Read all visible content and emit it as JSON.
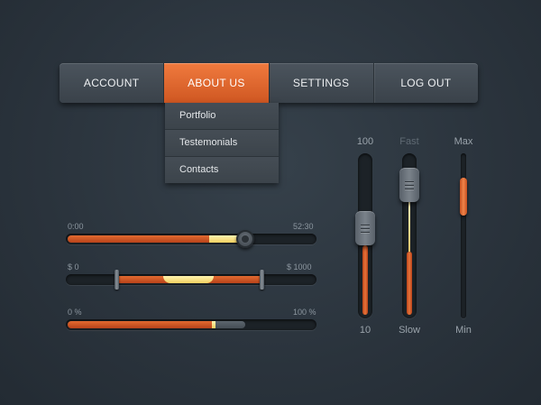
{
  "nav": {
    "items": [
      {
        "label": "ACCOUNT",
        "active": false
      },
      {
        "label": "ABOUT US",
        "active": true
      },
      {
        "label": "SETTINGS",
        "active": false
      },
      {
        "label": "LOG OUT",
        "active": false
      }
    ],
    "dropdown": [
      "Portfolio",
      "Testemonials",
      "Contacts"
    ]
  },
  "sliders": {
    "time": {
      "min_label": "0:00",
      "max_label": "52:30",
      "value_fraction": 0.72
    },
    "price": {
      "min_label": "$ 0",
      "max_label": "$ 1000",
      "low_fraction": 0.2,
      "high_fraction": 0.79
    },
    "progress": {
      "min_label": "0 %",
      "max_label": "100 %",
      "value_fraction": 0.6
    }
  },
  "vertical": {
    "volume": {
      "top_label": "100",
      "bottom_label": "10",
      "value_fraction": 0.55
    },
    "speed": {
      "top_label": "Fast",
      "bottom_label": "Slow",
      "value_fraction": 0.9
    },
    "range": {
      "top_label": "Max",
      "bottom_label": "Min",
      "value_fraction": 0.8
    }
  },
  "colors": {
    "accent": "#e0672e",
    "highlight": "#f7e08a",
    "background": "#2e3841"
  }
}
